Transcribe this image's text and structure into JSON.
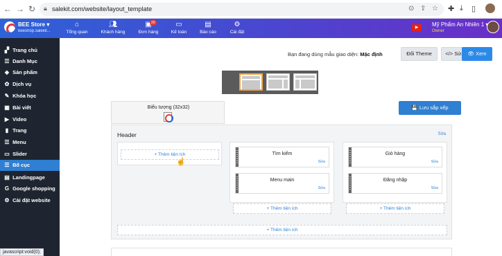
{
  "browser": {
    "url": "salekit.com/website/layout_template",
    "back_icon": "arrow-left",
    "forward_icon": "arrow-right",
    "reload_icon": "reload"
  },
  "topnav": {
    "brand_name": "BEE Store ▾",
    "brand_sub": "beeshop.salekit...",
    "items": [
      {
        "label": "Tổng quan",
        "icon": "home-icon"
      },
      {
        "label": "Khách hàng",
        "icon": "users-icon"
      },
      {
        "label": "Đơn hàng",
        "icon": "orders-icon",
        "badge": "20"
      },
      {
        "label": "Kế toán",
        "icon": "card-icon"
      },
      {
        "label": "Báo cáo",
        "icon": "report-icon"
      },
      {
        "label": "Cài đặt",
        "icon": "settings-icon"
      }
    ],
    "user_name": "Mỹ Phẩm An Nhiên 1 ▾",
    "user_role": "Owner"
  },
  "sidebar": {
    "items": [
      {
        "label": "Trang chủ",
        "icon": "dashboard-icon"
      },
      {
        "label": "Danh Mục",
        "icon": "list-icon"
      },
      {
        "label": "Sản phẩm",
        "icon": "box-icon"
      },
      {
        "label": "Dịch vụ",
        "icon": "service-icon"
      },
      {
        "label": "Khóa học",
        "icon": "graduation-icon"
      },
      {
        "label": "Bài viết",
        "icon": "article-icon"
      },
      {
        "label": "Video",
        "icon": "video-icon"
      },
      {
        "label": "Trang",
        "icon": "page-icon"
      },
      {
        "label": "Menu",
        "icon": "menu-icon"
      },
      {
        "label": "Slider",
        "icon": "slider-icon"
      },
      {
        "label": "Bố cục",
        "icon": "layout-icon",
        "active": true
      },
      {
        "label": "Landingpage",
        "icon": "landing-icon"
      },
      {
        "label": "Google shopping",
        "icon": "google-icon"
      },
      {
        "label": "Cài đặt website",
        "icon": "gear-icon"
      }
    ]
  },
  "main": {
    "theme_text_prefix": "Bạn đang dùng mẫu giao diện:",
    "theme_name": "Mặc định",
    "btn_change_theme": "Đổi Theme",
    "btn_edit_css": "</> Sửa css",
    "btn_view": "👁 Xem",
    "icon_card_label": "Biểu tượng (32x32)",
    "save_order": "💾 Lưu sắp xếp",
    "header_title": "Header",
    "header_edit": "Sửa",
    "add_widget": "+ Thêm tiện ích",
    "widgets_col2": [
      {
        "name": "Tìm kiếm",
        "edit": "Sửa"
      },
      {
        "name": "Menu main",
        "edit": "Sửa"
      }
    ],
    "widgets_col3": [
      {
        "name": "Giỏ hàng",
        "edit": "Sửa"
      },
      {
        "name": "Đăng nhập",
        "edit": "Sửa"
      }
    ]
  },
  "status_bar": "javascript:void(0);"
}
